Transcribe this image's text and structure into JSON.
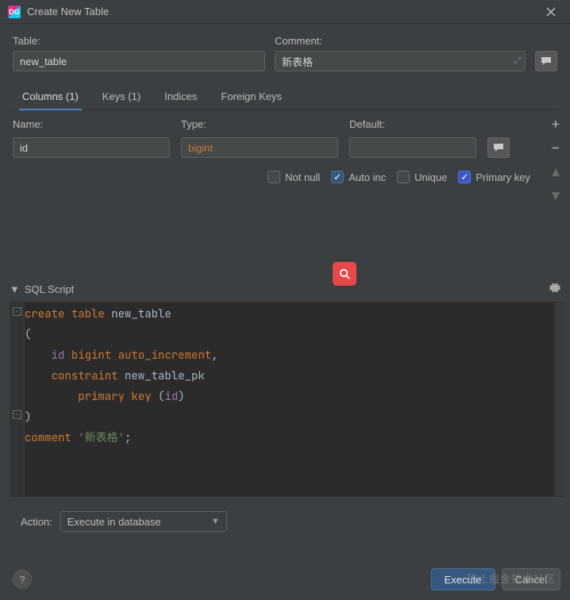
{
  "window": {
    "title": "Create New Table"
  },
  "form": {
    "table_label": "Table:",
    "table_value": "new_table",
    "comment_label": "Comment:",
    "comment_value": "新表格"
  },
  "tabs": {
    "columns": "Columns (1)",
    "keys": "Keys (1)",
    "indices": "Indices",
    "fks": "Foreign Keys"
  },
  "cols": {
    "name_label": "Name:",
    "name_value": "id",
    "type_label": "Type:",
    "type_value": "bigint",
    "default_label": "Default:",
    "default_value": ""
  },
  "checks": {
    "notnull": "Not null",
    "autoinc": "Auto inc",
    "unique": "Unique",
    "pk": "Primary key"
  },
  "sql": {
    "title": "SQL Script",
    "kw_create": "create",
    "kw_table": "table",
    "ident_table": "new_table",
    "open_paren": "(",
    "col_name": "id",
    "col_type": "bigint",
    "kw_autoinc": "auto_increment",
    "comma": ",",
    "kw_constraint": "constraint",
    "ident_pk": "new_table_pk",
    "kw_primary": "primary",
    "kw_key": "key",
    "pk_open": "(",
    "pk_col": "id",
    "pk_close": ")",
    "close_paren": ")",
    "kw_comment": "comment",
    "str_comment": "'新表格'",
    "semi": ";"
  },
  "action": {
    "label": "Action:",
    "selected": "Execute in database"
  },
  "buttons": {
    "execute": "Execute",
    "cancel": "Cancel"
  },
  "watermark": "稀土掘金技术社区"
}
